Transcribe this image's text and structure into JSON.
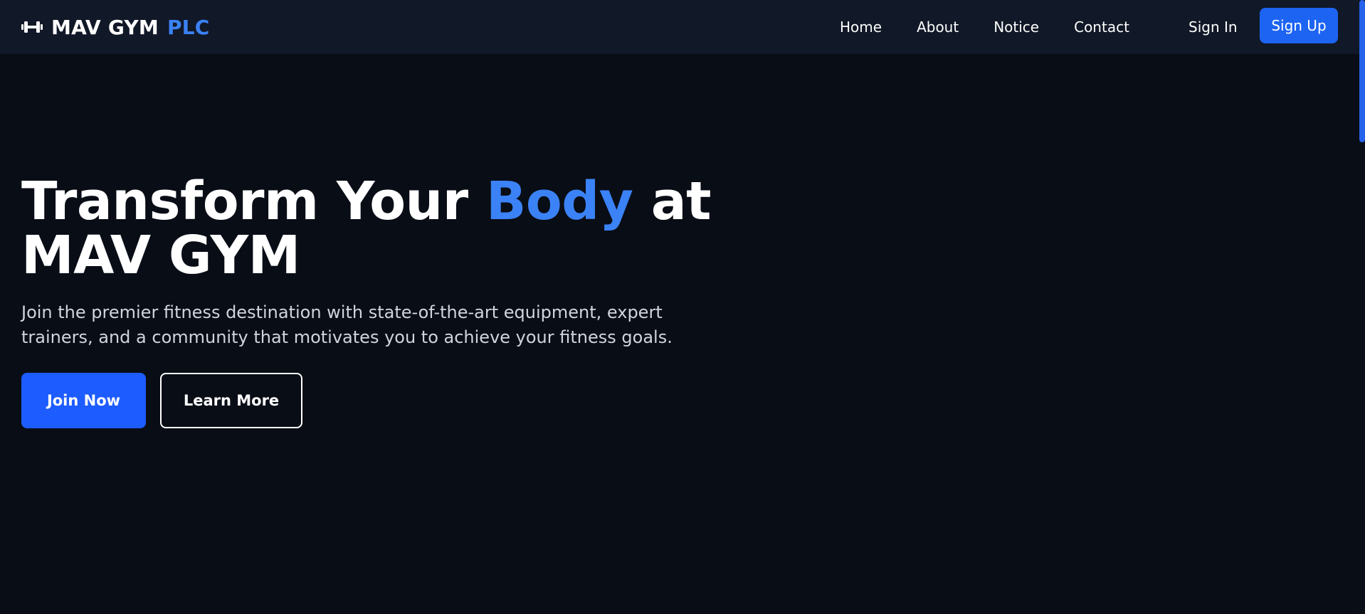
{
  "navbar": {
    "brand_name": "MAV GYM",
    "brand_suffix": "PLC",
    "brand_icon": "dumbbell-icon",
    "links": [
      {
        "label": "Home"
      },
      {
        "label": "About"
      },
      {
        "label": "Notice"
      },
      {
        "label": "Contact"
      }
    ],
    "signin_label": "Sign In",
    "signup_label": "Sign Up"
  },
  "hero": {
    "title_part1": "Transform Your ",
    "title_accent": "Body",
    "title_part2": " at",
    "title_line2": "MAV GYM",
    "subtitle": "Join the premier fitness destination with state-of-the-art equipment, expert trainers, and a community that motivates you to achieve your fitness goals.",
    "primary_button": "Join Now",
    "secondary_button": "Learn More"
  },
  "colors": {
    "background": "#090d16",
    "navbar": "#111827",
    "accent": "#3b82f6",
    "primary_button": "#1d5cff"
  }
}
